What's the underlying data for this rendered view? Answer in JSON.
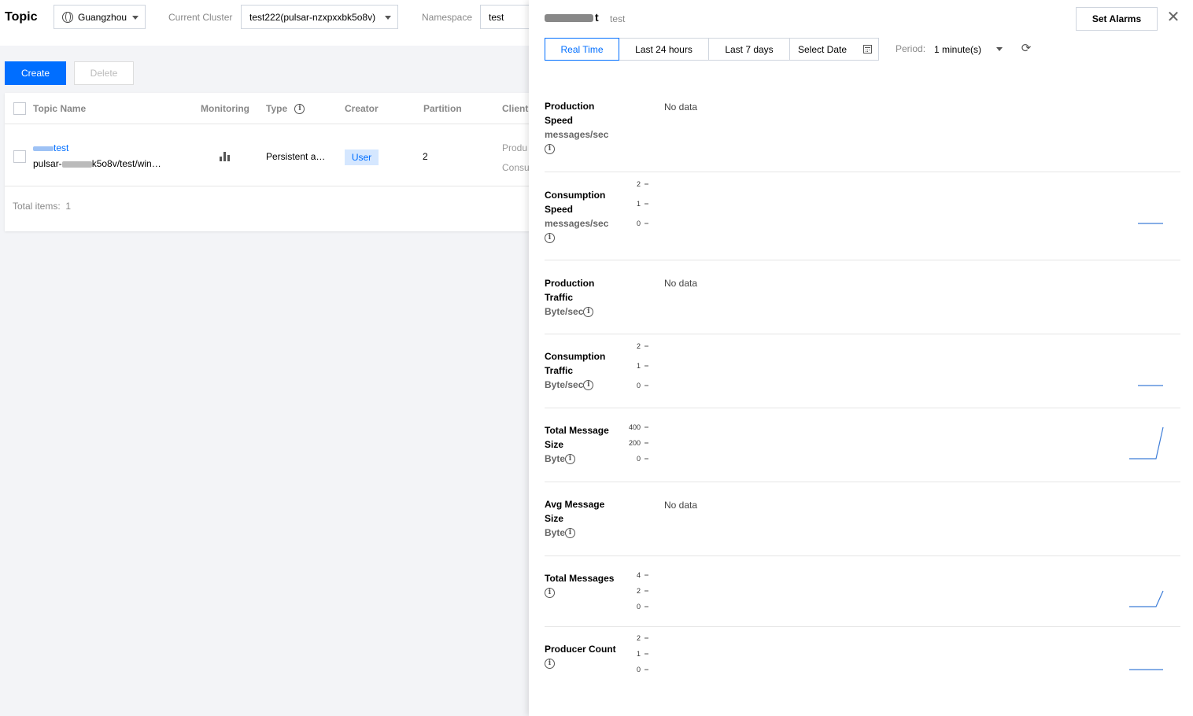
{
  "header": {
    "title": "Topic",
    "region": "Guangzhou",
    "cluster_label": "Current Cluster",
    "cluster_value": "test222(pulsar-nzxpxxbk5o8v)",
    "namespace_label": "Namespace",
    "namespace_value": "test"
  },
  "actions": {
    "create": "Create",
    "delete": "Delete"
  },
  "table": {
    "columns": [
      "Topic Name",
      "Monitoring",
      "Type",
      "Creator",
      "Partition",
      "Client"
    ],
    "rows": [
      {
        "name": "test",
        "path_prefix": "pulsar-",
        "path_suffix": "k5o8v/test/win…",
        "type": "Persistent a…",
        "creator": "User",
        "partition": "2",
        "client_line1": "Produ",
        "client_line2": "Consu"
      }
    ],
    "total_label": "Total items:",
    "total_value": "1"
  },
  "drawer": {
    "title_suffix": "t",
    "subtitle": "test",
    "set_alarms": "Set Alarms",
    "tabs": [
      "Real Time",
      "Last 24 hours",
      "Last 7 days",
      "Select Date"
    ],
    "active_tab": "Real Time",
    "period_label": "Period:",
    "period_value": "1 minute(s)",
    "no_data": "No data",
    "metrics": [
      {
        "name": "Production Speed",
        "unit": "messages/sec",
        "has_data": false
      },
      {
        "name": "Consumption Speed",
        "unit": "messages/sec",
        "has_data": true,
        "ticks": [
          "2",
          "1",
          "0"
        ],
        "series": [
          0,
          0
        ]
      },
      {
        "name": "Production Traffic",
        "unit": "Byte/sec",
        "has_data": false
      },
      {
        "name": "Consumption Traffic",
        "unit": "Byte/sec",
        "has_data": true,
        "ticks": [
          "2",
          "1",
          "0"
        ],
        "series": [
          0,
          0
        ]
      },
      {
        "name": "Total Message Size",
        "unit": "Byte",
        "has_data": true,
        "ticks": [
          "400",
          "200",
          "0"
        ],
        "series": [
          0,
          0,
          400
        ]
      },
      {
        "name": "Avg Message Size",
        "unit": "Byte",
        "has_data": false
      },
      {
        "name": "Total Messages",
        "unit": "",
        "has_data": true,
        "ticks": [
          "4",
          "2",
          "0"
        ],
        "series": [
          0,
          0,
          2
        ]
      },
      {
        "name": "Producer Count",
        "unit": "",
        "has_data": true,
        "ticks": [
          "2",
          "1",
          "0"
        ],
        "series": [
          0,
          0
        ]
      }
    ]
  },
  "colors": {
    "primary": "#006eff",
    "line": "#3d7dd8",
    "tag_bg": "#d5e7ff"
  }
}
